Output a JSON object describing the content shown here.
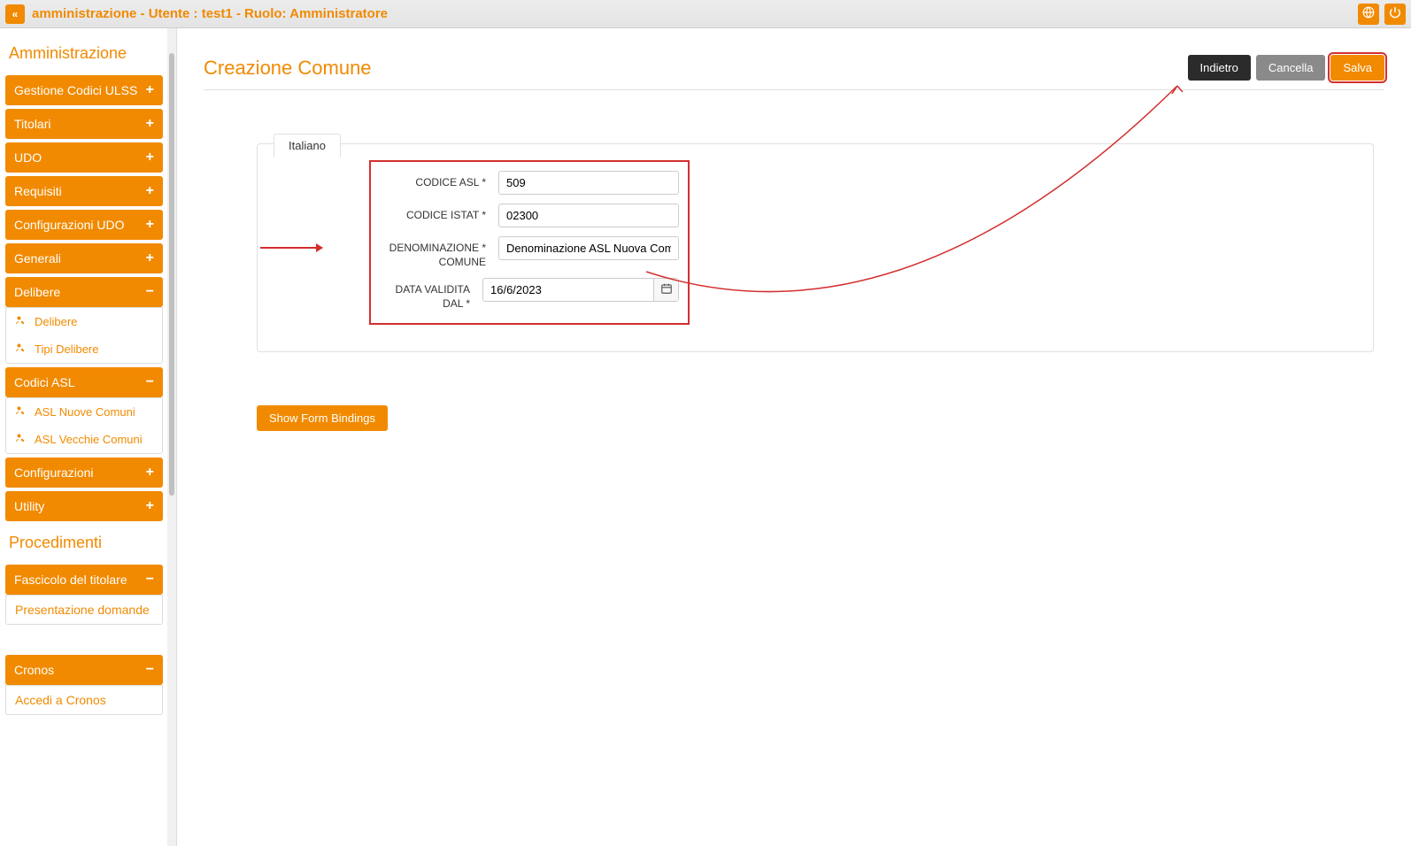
{
  "topbar": {
    "title": "amministrazione - Utente : test1 - Ruolo: Amministratore"
  },
  "sidebar": {
    "section1_title": "Amministrazione",
    "items1": [
      {
        "label": "Gestione Codici ULSS",
        "toggle": "+"
      },
      {
        "label": "Titolari",
        "toggle": "+"
      },
      {
        "label": "UDO",
        "toggle": "+"
      },
      {
        "label": "Requisiti",
        "toggle": "+"
      },
      {
        "label": "Configurazioni UDO",
        "toggle": "+"
      },
      {
        "label": "Generali",
        "toggle": "+"
      }
    ],
    "delibere": {
      "label": "Delibere",
      "toggle": "−",
      "children": [
        "Delibere",
        "Tipi Delibere"
      ]
    },
    "codiciasl": {
      "label": "Codici ASL",
      "toggle": "−",
      "children": [
        "ASL Nuove Comuni",
        "ASL Vecchie Comuni"
      ]
    },
    "items2": [
      {
        "label": "Configurazioni",
        "toggle": "+"
      },
      {
        "label": "Utility",
        "toggle": "+"
      }
    ],
    "section2_title": "Procedimenti",
    "fascicolo": {
      "label": "Fascicolo del titolare",
      "toggle": "−",
      "children": [
        "Presentazione domande"
      ]
    },
    "cronos": {
      "label": "Cronos",
      "toggle": "−",
      "children": [
        "Accedi a Cronos"
      ]
    }
  },
  "page": {
    "title": "Creazione Comune",
    "btn_back": "Indietro",
    "btn_cancel": "Cancella",
    "btn_save": "Salva",
    "tab": "Italiano"
  },
  "form": {
    "codice_asl_label": "CODICE ASL *",
    "codice_asl_value": "509",
    "codice_istat_label": "CODICE ISTAT *",
    "codice_istat_value": "02300",
    "denominazione_label": "DENOMINAZIONE * COMUNE",
    "denominazione_value": "Denominazione ASL Nuova Comune",
    "data_label": "DATA VALIDITA DAL *",
    "data_value": "16/6/2023"
  },
  "actions": {
    "show_bindings": "Show Form Bindings"
  }
}
